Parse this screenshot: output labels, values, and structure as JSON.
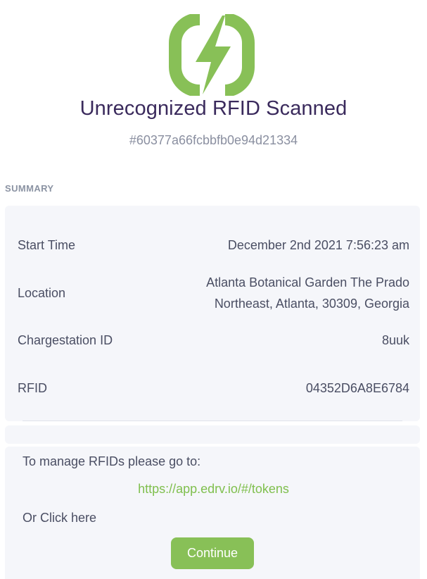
{
  "header": {
    "logo_icon": "lightning-bolt-icon",
    "brand_color": "#88c057",
    "title": "Unrecognized RFID Scanned",
    "id": "#60377a66fcbbfb0e94d21334"
  },
  "summary": {
    "section_label": "SUMMARY",
    "rows": [
      {
        "label": "Start Time",
        "value": "December 2nd 2021 7:56:23 am"
      },
      {
        "label": "Location",
        "value_line1": "Atlanta Botanical Garden The Prado",
        "value_line2": "Northeast, Atlanta, 30309, Georgia"
      },
      {
        "label": "Chargestation ID",
        "value": "8uuk"
      },
      {
        "label": "RFID",
        "value": "04352D6A8E6784"
      }
    ]
  },
  "footer": {
    "manage_text": "To manage RFIDs please go to:",
    "link_text": "https://app.edrv.io/#/tokens",
    "or_click_text": "Or Click here",
    "button_label": "Continue"
  }
}
